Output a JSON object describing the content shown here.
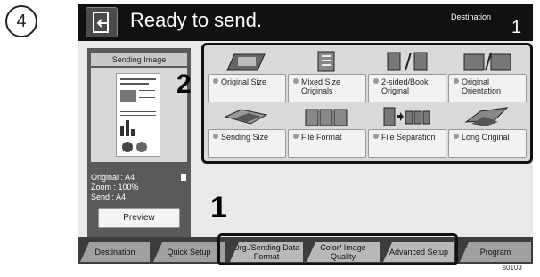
{
  "step_number": "4",
  "header": {
    "title": "Ready to send.",
    "destination_label": "Destination",
    "destination_count": "1"
  },
  "preview": {
    "title": "Sending Image",
    "info": [
      {
        "label": "Original",
        "value": ": A4"
      },
      {
        "label": "Zoom",
        "value": ": 100%"
      },
      {
        "label": "Send",
        "value": ": A4"
      }
    ],
    "button": "Preview"
  },
  "callouts": {
    "options": "2",
    "tabs": "1"
  },
  "options": [
    {
      "label": "Original Size",
      "icon": "original-size-icon"
    },
    {
      "label": "Mixed Size Originals",
      "icon": "mixed-size-icon"
    },
    {
      "label": "2-sided/Book Original",
      "icon": "2-sided-book-icon"
    },
    {
      "label": "Original Orientation",
      "icon": "orientation-icon"
    },
    {
      "label": "Sending Size",
      "icon": "sending-size-icon"
    },
    {
      "label": "File Format",
      "icon": "file-format-icon"
    },
    {
      "label": "File Separation",
      "icon": "file-separation-icon"
    },
    {
      "label": "Long Original",
      "icon": "long-original-icon"
    }
  ],
  "tabs": [
    "Destination",
    "Quick Setup",
    "Org./Sending Data Format",
    "Color/ Image Quality",
    "Advanced Setup",
    "Program"
  ],
  "figure_code": "s0103",
  "colors": {
    "header_bg": "#111111",
    "panel_bg": "#5a5a5a",
    "frame": "#111111"
  }
}
